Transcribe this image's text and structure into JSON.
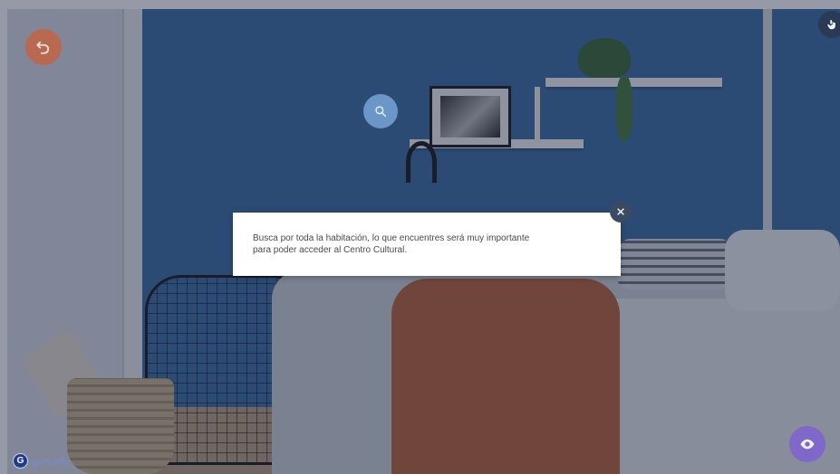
{
  "modal": {
    "text_line1": "Busca por toda la habitación, lo que encuentres será muy importante",
    "text_line2": "para poder acceder al Centro Cultural."
  },
  "branding": {
    "logo_letter": "G",
    "name": "genially"
  },
  "icons": {
    "back": "undo-arrow-icon",
    "search": "magnifier-icon",
    "gesture": "hand-tap-icon",
    "eye": "eye-icon",
    "close": "close-icon"
  },
  "colors": {
    "back_button": "#b8694f",
    "search_button": "#6a97c8",
    "eye_button": "#7f68c9",
    "close_button": "#3b4a63"
  }
}
